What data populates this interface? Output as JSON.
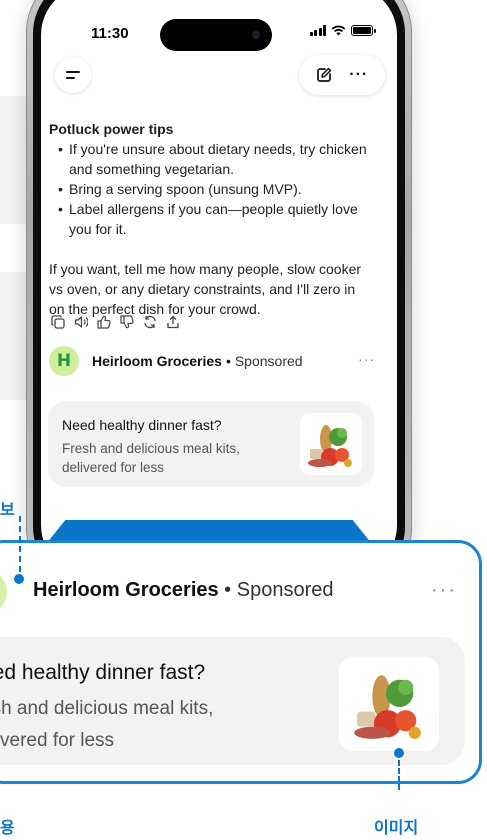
{
  "status_bar": {
    "time": "11:30"
  },
  "tips": {
    "title": "Potluck power tips",
    "items": [
      "If you're unsure about dietary needs, try chicken and something vegetarian.",
      "Bring a serving spoon (unsung MVP).",
      "Label allergens if you can—people quietly love you for it."
    ]
  },
  "followup": "If you want, tell me how many people, slow cooker vs oven, or any dietary constraints, and I'll zero in on the perfect dish for your crowd.",
  "ad": {
    "logo_letter": "H",
    "advertiser": "Heirloom Groceries",
    "separator": "•",
    "sponsored": "Sponsored",
    "more": "···",
    "title": "Need healthy dinner fast?",
    "description": "Fresh and delicious meal kits, delivered for less"
  },
  "zoom": {
    "advertiser": "Heirloom Groceries",
    "separator": " • ",
    "sponsored": "Sponsored",
    "more": "···",
    "title": "eed healthy dinner fast?",
    "description_line1": "esh and delicious meal kits,",
    "description_line2": "elivered for less"
  },
  "callouts": {
    "top_left": "보",
    "bottom_left": "용",
    "bottom_right": "이미지"
  },
  "icons": {
    "menu": "hamburger-icon",
    "edit": "compose-icon",
    "more": "ellipsis-icon",
    "copy": "copy-icon",
    "speaker": "speaker-icon",
    "like": "thumbs-up-icon",
    "dislike": "thumbs-down-icon",
    "regenerate": "refresh-icon",
    "share": "share-icon"
  },
  "colors": {
    "accent": "#0a76c9",
    "logo_bg": "#cfee9b",
    "logo_letter": "#1f9b3a"
  }
}
